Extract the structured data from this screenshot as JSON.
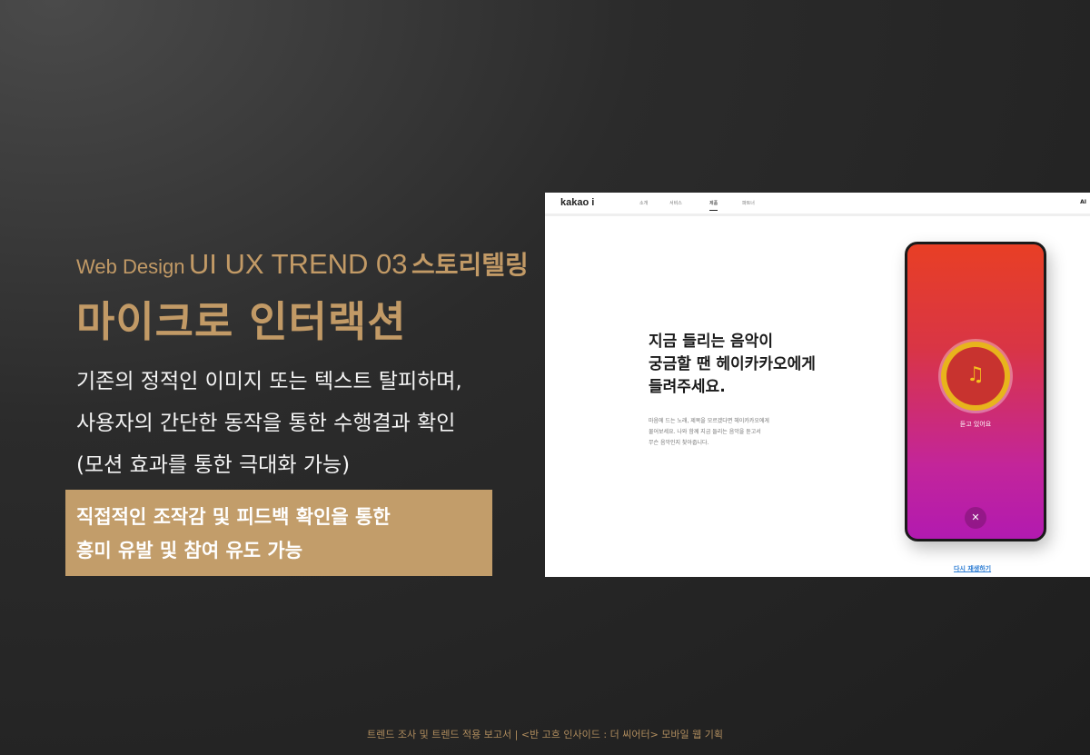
{
  "slide": {
    "subtitle_small": "Web Design",
    "subtitle_big": "UI UX TREND 03",
    "subtitle_ko": "스토리텔링",
    "title": "마이크로 인터랙션",
    "desc_lines": [
      "기존의 정적인 이미지 또는 텍스트 탈피하며,",
      "사용자의 간단한 동작을 통한 수행결과 확인",
      "(모션 효과를 통한 극대화 가능)"
    ],
    "highlight_lines": [
      "직접적인 조작감 및 피드백 확인을 통한",
      "흥미 유발 및 참여 유도 가능"
    ],
    "footer": "트렌드 조사 및 트렌드 적용 보고서 | <반 고흐 인사이드 : 더 씨어터> 모바일 웹 기획",
    "accent_color": "#c29a66"
  },
  "screenshot": {
    "logo": "kakao i",
    "nav": [
      "소개",
      "서비스",
      "제품",
      "파트너"
    ],
    "nav_active": "제품",
    "nav_right": "AI",
    "hero_lines": [
      "지금 들리는 음악이",
      "궁금할 땐 헤이카카오에게",
      "들려주세요."
    ],
    "hero_desc_lines": [
      "마음에 드는 노래, 제목을 모르겠다면 헤이카카오에게",
      "물어보세요. 나와 함께 지금 들리는 음악을 듣고서",
      "무슨 음악인지 찾아줍니다."
    ],
    "phone_status": "듣고 있어요",
    "music_icon": "music-note-icon",
    "close_icon": "close-icon",
    "replay_link": "다시 재생하기",
    "link_color": "#2b7cd3"
  }
}
